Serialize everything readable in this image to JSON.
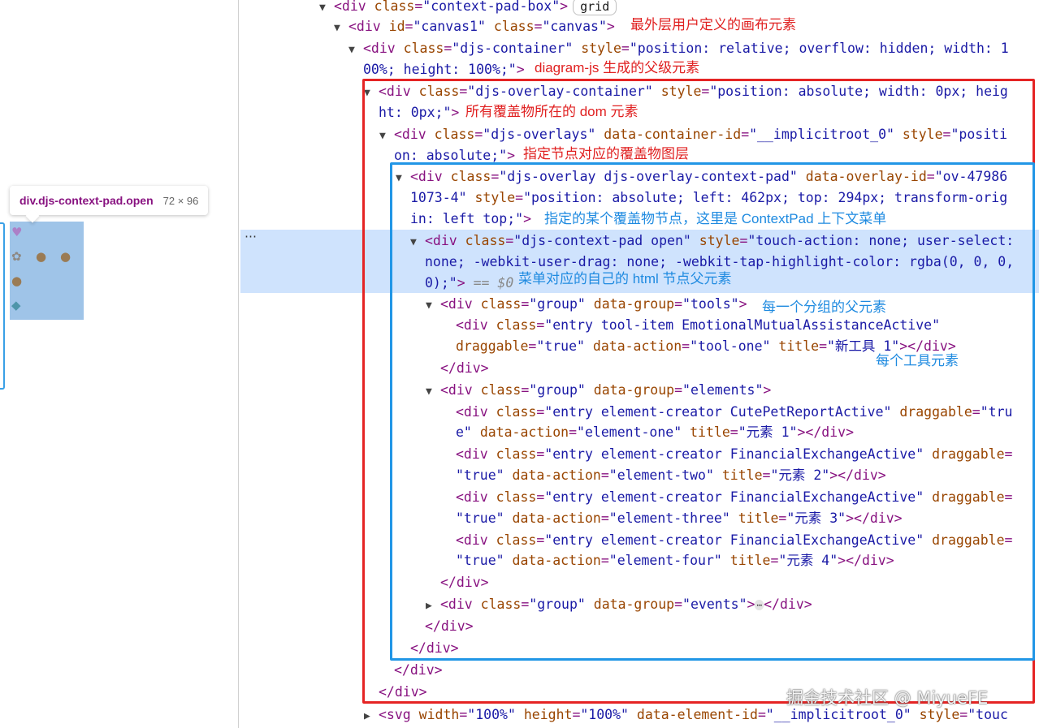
{
  "tooltip": {
    "selector": "div.djs-context-pad.open",
    "size": "72 × 96"
  },
  "pad_icons": [
    "heart-icon",
    "paw-icon",
    "money-bag-icon",
    "money-bag-icon",
    "money-bag-icon",
    "bird-icon"
  ],
  "row_menu": "⋯",
  "lines": [
    {
      "tri": "▼",
      "p": [
        [
          "t",
          "<div "
        ],
        [
          "a",
          "class"
        ],
        [
          "t",
          "="
        ],
        [
          "v",
          "\"context-pad-box\""
        ],
        [
          "t",
          ">"
        ]
      ],
      "badge": "grid"
    },
    {
      "tri": "▼",
      "p": [
        [
          "t",
          "<div "
        ],
        [
          "a",
          "id"
        ],
        [
          "t",
          "="
        ],
        [
          "v",
          "\"canvas1\""
        ],
        [
          "t",
          " "
        ],
        [
          "a",
          "class"
        ],
        [
          "t",
          "="
        ],
        [
          "v",
          "\"canvas\""
        ],
        [
          "t",
          ">"
        ]
      ]
    },
    {
      "tri": "▼",
      "p": [
        [
          "t",
          "<div "
        ],
        [
          "a",
          "class"
        ],
        [
          "t",
          "="
        ],
        [
          "v",
          "\"djs-container\""
        ],
        [
          "t",
          " "
        ],
        [
          "a",
          "style"
        ],
        [
          "t",
          "="
        ],
        [
          "v",
          "\"position: relative; overflow: hidden; width: 1"
        ]
      ]
    },
    {
      "tri": "",
      "p": [
        [
          "v",
          "00%; height: 100%;\""
        ],
        [
          "t",
          ">"
        ]
      ]
    },
    {
      "tri": "▼",
      "p": [
        [
          "t",
          "<div "
        ],
        [
          "a",
          "class"
        ],
        [
          "t",
          "="
        ],
        [
          "v",
          "\"djs-overlay-container\""
        ],
        [
          "t",
          " "
        ],
        [
          "a",
          "style"
        ],
        [
          "t",
          "="
        ],
        [
          "v",
          "\"position: absolute; width: 0px; heig"
        ]
      ]
    },
    {
      "tri": "",
      "p": [
        [
          "v",
          "ht: 0px;\""
        ],
        [
          "t",
          ">"
        ]
      ]
    },
    {
      "tri": "▼",
      "p": [
        [
          "t",
          "<div "
        ],
        [
          "a",
          "class"
        ],
        [
          "t",
          "="
        ],
        [
          "v",
          "\"djs-overlays\""
        ],
        [
          "t",
          " "
        ],
        [
          "a",
          "data-container-id"
        ],
        [
          "t",
          "="
        ],
        [
          "v",
          "\"__implicitroot_0\""
        ],
        [
          "t",
          " "
        ],
        [
          "a",
          "style"
        ],
        [
          "t",
          "="
        ],
        [
          "v",
          "\"positi"
        ]
      ]
    },
    {
      "tri": "",
      "p": [
        [
          "v",
          "on: absolute;\""
        ],
        [
          "t",
          ">"
        ]
      ]
    },
    {
      "tri": "▼",
      "p": [
        [
          "t",
          "<div "
        ],
        [
          "a",
          "class"
        ],
        [
          "t",
          "="
        ],
        [
          "v",
          "\"djs-overlay djs-overlay-context-pad\""
        ],
        [
          "t",
          " "
        ],
        [
          "a",
          "data-overlay-id"
        ],
        [
          "t",
          "="
        ],
        [
          "v",
          "\"ov-47986"
        ]
      ]
    },
    {
      "tri": "",
      "p": [
        [
          "v",
          "1073-4\""
        ],
        [
          "t",
          " "
        ],
        [
          "a",
          "style"
        ],
        [
          "t",
          "="
        ],
        [
          "v",
          "\"position: absolute; left: 462px; top: 294px; transform-orig"
        ]
      ]
    },
    {
      "tri": "",
      "p": [
        [
          "v",
          "in: left top;\""
        ],
        [
          "t",
          ">"
        ]
      ]
    },
    {
      "tri": "▼",
      "p": [
        [
          "t",
          "<div "
        ],
        [
          "a",
          "class"
        ],
        [
          "t",
          "="
        ],
        [
          "v",
          "\"djs-context-pad open\""
        ],
        [
          "t",
          " "
        ],
        [
          "a",
          "style"
        ],
        [
          "t",
          "="
        ],
        [
          "v",
          "\"touch-action: none; user-select:"
        ]
      ]
    },
    {
      "tri": "",
      "p": [
        [
          "v",
          "none; -webkit-user-drag: none; -webkit-tap-highlight-color: rgba(0, 0, 0,"
        ]
      ]
    },
    {
      "tri": "",
      "p": [
        [
          "v",
          "0);\""
        ],
        [
          "t",
          "> "
        ],
        [
          "e",
          "== $0"
        ]
      ]
    },
    {
      "tri": "▼",
      "p": [
        [
          "t",
          "<div "
        ],
        [
          "a",
          "class"
        ],
        [
          "t",
          "="
        ],
        [
          "v",
          "\"group\""
        ],
        [
          "t",
          " "
        ],
        [
          "a",
          "data-group"
        ],
        [
          "t",
          "="
        ],
        [
          "v",
          "\"tools\""
        ],
        [
          "t",
          ">"
        ]
      ]
    },
    {
      "tri": "",
      "p": [
        [
          "t",
          "<div "
        ],
        [
          "a",
          "class"
        ],
        [
          "t",
          "="
        ],
        [
          "v",
          "\"entry tool-item EmotionalMutualAssistanceActive\""
        ]
      ]
    },
    {
      "tri": "",
      "p": [
        [
          "a",
          "draggable"
        ],
        [
          "t",
          "="
        ],
        [
          "v",
          "\"true\""
        ],
        [
          "t",
          " "
        ],
        [
          "a",
          "data-action"
        ],
        [
          "t",
          "="
        ],
        [
          "v",
          "\"tool-one\""
        ],
        [
          "t",
          " "
        ],
        [
          "a",
          "title"
        ],
        [
          "t",
          "="
        ],
        [
          "v",
          "\"新工具 1\""
        ],
        [
          "t",
          "></div>"
        ]
      ]
    },
    {
      "tri": "",
      "p": [
        [
          "t",
          "</div>"
        ]
      ]
    },
    {
      "tri": "▼",
      "p": [
        [
          "t",
          "<div "
        ],
        [
          "a",
          "class"
        ],
        [
          "t",
          "="
        ],
        [
          "v",
          "\"group\""
        ],
        [
          "t",
          " "
        ],
        [
          "a",
          "data-group"
        ],
        [
          "t",
          "="
        ],
        [
          "v",
          "\"elements\""
        ],
        [
          "t",
          ">"
        ]
      ]
    },
    {
      "tri": "",
      "p": [
        [
          "t",
          "<div "
        ],
        [
          "a",
          "class"
        ],
        [
          "t",
          "="
        ],
        [
          "v",
          "\"entry element-creator CutePetReportActive\""
        ],
        [
          "t",
          " "
        ],
        [
          "a",
          "draggable"
        ],
        [
          "t",
          "="
        ],
        [
          "v",
          "\"tru"
        ]
      ]
    },
    {
      "tri": "",
      "p": [
        [
          "v",
          "e\""
        ],
        [
          "t",
          " "
        ],
        [
          "a",
          "data-action"
        ],
        [
          "t",
          "="
        ],
        [
          "v",
          "\"element-one\""
        ],
        [
          "t",
          " "
        ],
        [
          "a",
          "title"
        ],
        [
          "t",
          "="
        ],
        [
          "v",
          "\"元素 1\""
        ],
        [
          "t",
          "></div>"
        ]
      ]
    },
    {
      "tri": "",
      "p": [
        [
          "t",
          "<div "
        ],
        [
          "a",
          "class"
        ],
        [
          "t",
          "="
        ],
        [
          "v",
          "\"entry element-creator FinancialExchangeActive\""
        ],
        [
          "t",
          " "
        ],
        [
          "a",
          "draggable"
        ],
        [
          "t",
          "="
        ]
      ]
    },
    {
      "tri": "",
      "p": [
        [
          "v",
          "\"true\""
        ],
        [
          "t",
          " "
        ],
        [
          "a",
          "data-action"
        ],
        [
          "t",
          "="
        ],
        [
          "v",
          "\"element-two\""
        ],
        [
          "t",
          " "
        ],
        [
          "a",
          "title"
        ],
        [
          "t",
          "="
        ],
        [
          "v",
          "\"元素 2\""
        ],
        [
          "t",
          "></div>"
        ]
      ]
    },
    {
      "tri": "",
      "p": [
        [
          "t",
          "<div "
        ],
        [
          "a",
          "class"
        ],
        [
          "t",
          "="
        ],
        [
          "v",
          "\"entry element-creator FinancialExchangeActive\""
        ],
        [
          "t",
          " "
        ],
        [
          "a",
          "draggable"
        ],
        [
          "t",
          "="
        ]
      ]
    },
    {
      "tri": "",
      "p": [
        [
          "v",
          "\"true\""
        ],
        [
          "t",
          " "
        ],
        [
          "a",
          "data-action"
        ],
        [
          "t",
          "="
        ],
        [
          "v",
          "\"element-three\""
        ],
        [
          "t",
          " "
        ],
        [
          "a",
          "title"
        ],
        [
          "t",
          "="
        ],
        [
          "v",
          "\"元素 3\""
        ],
        [
          "t",
          "></div>"
        ]
      ]
    },
    {
      "tri": "",
      "p": [
        [
          "t",
          "<div "
        ],
        [
          "a",
          "class"
        ],
        [
          "t",
          "="
        ],
        [
          "v",
          "\"entry element-creator FinancialExchangeActive\""
        ],
        [
          "t",
          " "
        ],
        [
          "a",
          "draggable"
        ],
        [
          "t",
          "="
        ]
      ]
    },
    {
      "tri": "",
      "p": [
        [
          "v",
          "\"true\""
        ],
        [
          "t",
          " "
        ],
        [
          "a",
          "data-action"
        ],
        [
          "t",
          "="
        ],
        [
          "v",
          "\"element-four\""
        ],
        [
          "t",
          " "
        ],
        [
          "a",
          "title"
        ],
        [
          "t",
          "="
        ],
        [
          "v",
          "\"元素 4\""
        ],
        [
          "t",
          "></div>"
        ]
      ]
    },
    {
      "tri": "",
      "p": [
        [
          "t",
          "</div>"
        ]
      ]
    },
    {
      "tri": "▶",
      "p": [
        [
          "t",
          "<div "
        ],
        [
          "a",
          "class"
        ],
        [
          "t",
          "="
        ],
        [
          "v",
          "\"group\""
        ],
        [
          "t",
          " "
        ],
        [
          "a",
          "data-group"
        ],
        [
          "t",
          "="
        ],
        [
          "v",
          "\"events\""
        ],
        [
          "t",
          ">"
        ],
        [
          "d",
          "⋯"
        ],
        [
          "t",
          "</div>"
        ]
      ]
    },
    {
      "tri": "",
      "p": [
        [
          "t",
          "</div>"
        ]
      ]
    },
    {
      "tri": "",
      "p": [
        [
          "t",
          "</div>"
        ]
      ]
    },
    {
      "tri": "",
      "p": [
        [
          "t",
          "</div>"
        ]
      ]
    },
    {
      "tri": "",
      "p": [
        [
          "t",
          "</div>"
        ]
      ]
    },
    {
      "tri": "▶",
      "p": [
        [
          "t",
          "<svg "
        ],
        [
          "a",
          "width"
        ],
        [
          "t",
          "="
        ],
        [
          "v",
          "\"100%\""
        ],
        [
          "t",
          " "
        ],
        [
          "a",
          "height"
        ],
        [
          "t",
          "="
        ],
        [
          "v",
          "\"100%\""
        ],
        [
          "t",
          " "
        ],
        [
          "a",
          "data-element-id"
        ],
        [
          "t",
          "="
        ],
        [
          "v",
          "\"__implicitroot_0\""
        ],
        [
          "t",
          " "
        ],
        [
          "a",
          "style"
        ],
        [
          "t",
          "="
        ],
        [
          "v",
          "\"touc"
        ]
      ]
    }
  ],
  "annotations": {
    "canvas": "最外层用户定义的画布元素",
    "container": "diagram-js 生成的父级元素",
    "overlay_container": "所有覆盖物所在的 dom 元素",
    "overlays": "指定节点对应的覆盖物图层",
    "overlay": "指定的某个覆盖物节点，这里是 ContextPad 上下文菜单",
    "context_pad": "菜单对应的自己的 html 节点父元素",
    "group": "每一个分组的父元素",
    "tool": "每个工具元素"
  },
  "watermark": "掘金技术社区 @ MiyueFE",
  "colors": {
    "red_box": "#e52424",
    "blue_box": "#2196e6",
    "selection": "#cfe3fd",
    "tag": "#881280",
    "attr": "#994500",
    "value": "#1a1aa6"
  }
}
